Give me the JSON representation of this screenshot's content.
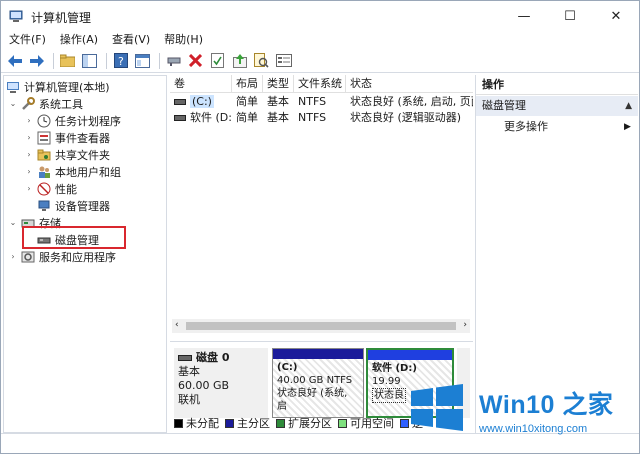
{
  "window": {
    "title": "计算机管理",
    "controls": {
      "minimize": "—",
      "maximize": "☐",
      "close": "✕"
    }
  },
  "menu": [
    "文件(F)",
    "操作(A)",
    "查看(V)",
    "帮助(H)"
  ],
  "toolbar_icons": [
    "back-icon",
    "forward-icon",
    "folder-up-icon",
    "show-tree-icon",
    "help-icon",
    "console-icon",
    "connect-icon",
    "delete-icon",
    "check-icon",
    "export-icon",
    "search-icon",
    "properties-icon"
  ],
  "tree": {
    "root": "计算机管理(本地)",
    "system_tools": "系统工具",
    "task_scheduler": "任务计划程序",
    "event_viewer": "事件查看器",
    "shared_folders": "共享文件夹",
    "local_users": "本地用户和组",
    "performance": "性能",
    "device_manager": "设备管理器",
    "storage": "存储",
    "disk_management": "磁盘管理",
    "services": "服务和应用程序"
  },
  "list": {
    "headers": [
      "卷",
      "布局",
      "类型",
      "文件系统",
      "状态"
    ],
    "rows": [
      {
        "volume": "(C:)",
        "layout": "简单",
        "type": "基本",
        "fs": "NTFS",
        "status": "状态良好 (系统, 启动, 页面"
      },
      {
        "volume": "软件 (D:)",
        "layout": "简单",
        "type": "基本",
        "fs": "NTFS",
        "status": "状态良好 (逻辑驱动器)"
      }
    ]
  },
  "disk": {
    "name": "磁盘 0",
    "type": "基本",
    "size": "60.00 GB",
    "state": "联机",
    "partitions": [
      {
        "label": "(C:)",
        "size": "40.00 GB NTFS",
        "status": "状态良好 (系统, 启"
      },
      {
        "label": "软件 (D:)",
        "size": "19.99",
        "status": "状态良"
      }
    ]
  },
  "legend": [
    {
      "label": "未分配",
      "color": "#000000"
    },
    {
      "label": "主分区",
      "color": "#1b1b9a"
    },
    {
      "label": "扩展分区",
      "color": "#2e8b3a"
    },
    {
      "label": "可用空间",
      "color": "#7ee07e"
    },
    {
      "label": "逻",
      "color": "#3060ff"
    }
  ],
  "actions": {
    "title": "操作",
    "section": "磁盘管理",
    "more": "更多操作"
  },
  "watermark": {
    "brand": "Win10 之家",
    "url": "www.win10xitong.com",
    "color": "#1c7fd3"
  }
}
